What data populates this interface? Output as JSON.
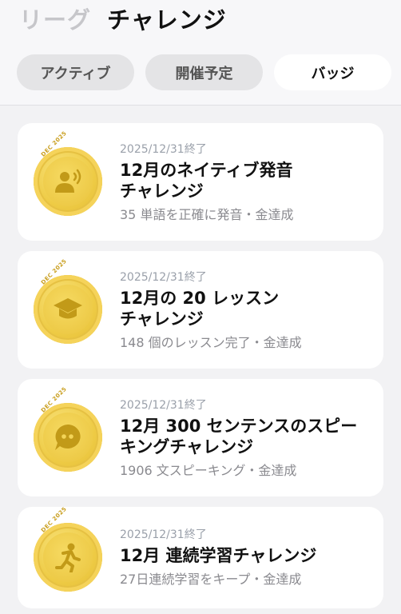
{
  "top_tabs": {
    "league": "リーグ",
    "challenge": "チャレンジ"
  },
  "segments": [
    "アクティブ",
    "開催予定",
    "バッジ"
  ],
  "medal_tag": "DEC 2025",
  "challenges": [
    {
      "date": "2025/12/31終了",
      "title_line1": "12月のネイティブ発音",
      "title_line2": "チャレンジ",
      "subtitle": "35 単語を正確に発音・金達成",
      "icon": "pronunciation-icon"
    },
    {
      "date": "2025/12/31終了",
      "title_line1": "12月の 20 レッスン",
      "title_line2": "チャレンジ",
      "subtitle": "148 個のレッスン完了・金達成",
      "icon": "graduation-cap-icon"
    },
    {
      "date": "2025/12/31終了",
      "title_line1": "12月 300 センテンスのスピー",
      "title_line2": "キングチャレンジ",
      "subtitle": "1906 文スピーキング・金達成",
      "icon": "speech-bubble-icon"
    },
    {
      "date": "2025/12/31終了",
      "title_line1": "12月 連続学習チャレンジ",
      "title_line2": "",
      "subtitle": "27日連続学習をキープ・金達成",
      "icon": "running-person-icon"
    }
  ]
}
